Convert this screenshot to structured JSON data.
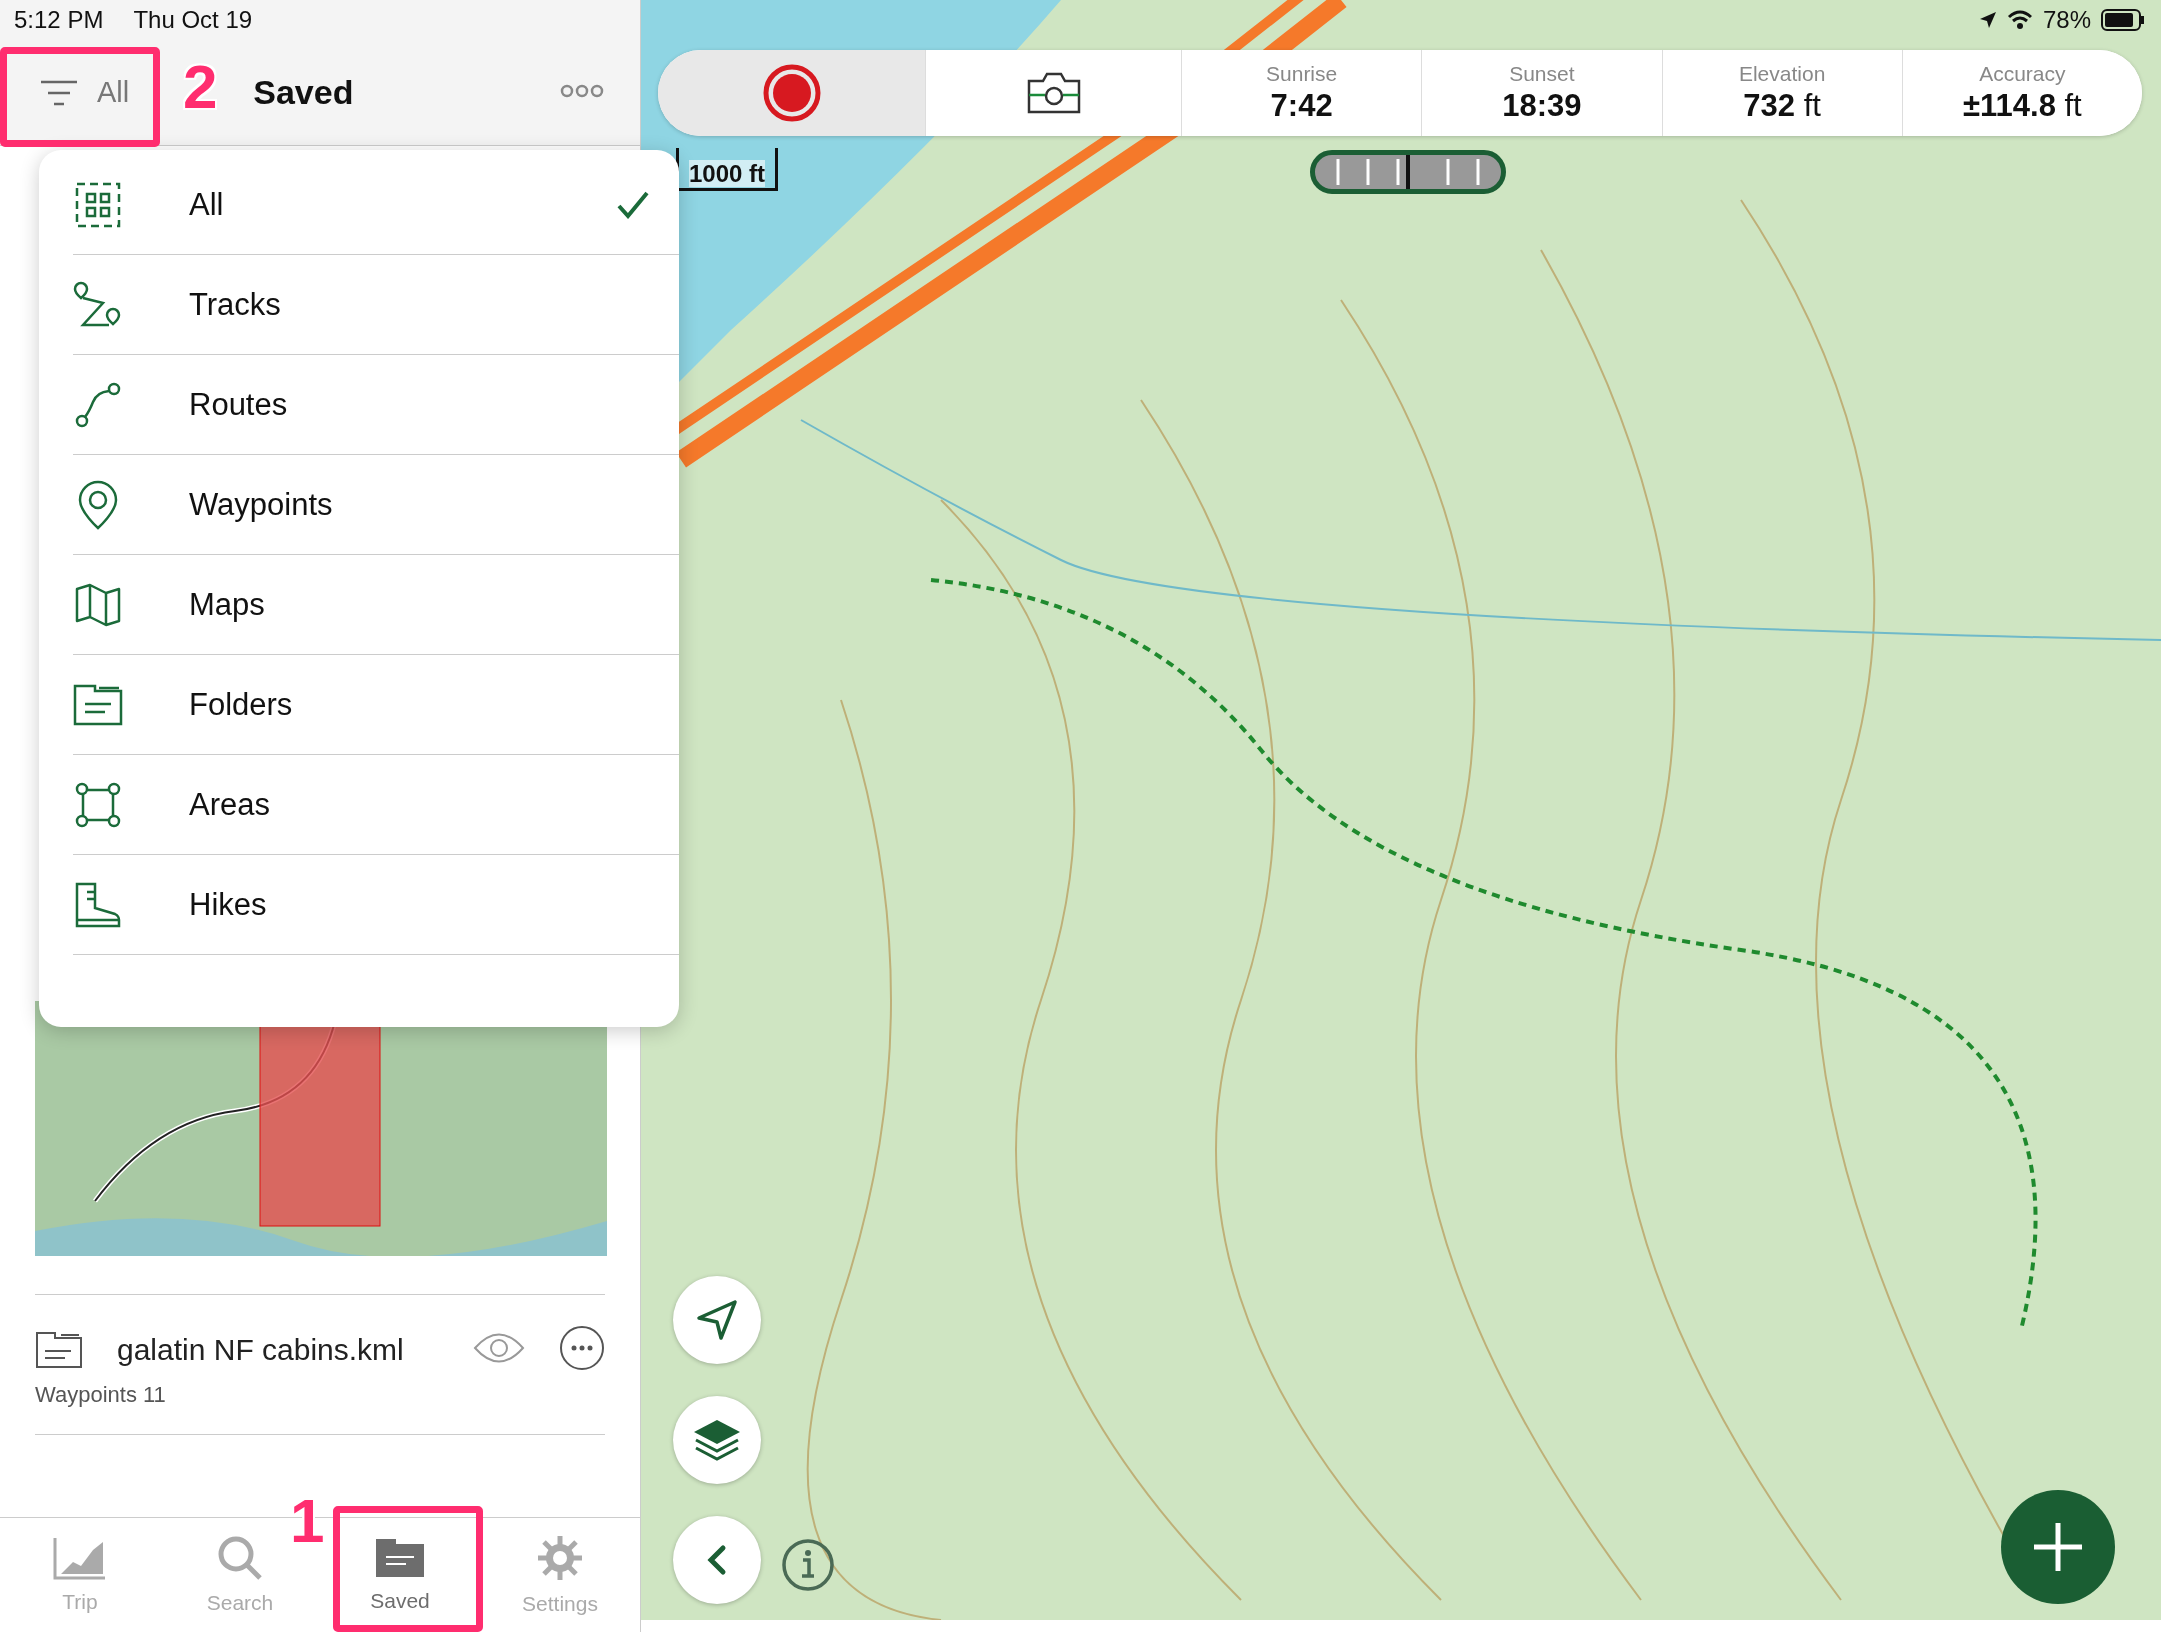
{
  "status_bar": {
    "time": "5:12 PM",
    "date": "Thu Oct 19",
    "battery": "78%"
  },
  "header": {
    "filter_button": {
      "label": "All"
    },
    "title": "Saved"
  },
  "callouts": [
    "2",
    "1"
  ],
  "filter_menu": {
    "items": [
      {
        "label": "All",
        "kind": "all",
        "selected": true
      },
      {
        "label": "Tracks",
        "kind": "tracks",
        "selected": false
      },
      {
        "label": "Routes",
        "kind": "routes",
        "selected": false
      },
      {
        "label": "Waypoints",
        "kind": "waypoints",
        "selected": false
      },
      {
        "label": "Maps",
        "kind": "maps",
        "selected": false
      },
      {
        "label": "Folders",
        "kind": "folders",
        "selected": false
      },
      {
        "label": "Areas",
        "kind": "areas",
        "selected": false
      },
      {
        "label": "Hikes",
        "kind": "hikes",
        "selected": false
      }
    ]
  },
  "saved_list": {
    "items": [
      {
        "name": "galatin NF cabins.kml",
        "detail": "Waypoints 11"
      }
    ]
  },
  "tab_bar": {
    "tabs": [
      {
        "label": "Trip",
        "kind": "trip",
        "selected": false
      },
      {
        "label": "Search",
        "kind": "search",
        "selected": false
      },
      {
        "label": "Saved",
        "kind": "saved",
        "selected": true
      },
      {
        "label": "Settings",
        "kind": "settings",
        "selected": false
      }
    ]
  },
  "map_toolbar": {
    "stats": [
      {
        "label": "Sunrise",
        "value": "7:42"
      },
      {
        "label": "Sunset",
        "value": "18:39"
      },
      {
        "label": "Elevation",
        "value": "732",
        "unit": "ft"
      },
      {
        "label": "Accuracy",
        "value": "±114.8",
        "unit": "ft"
      }
    ]
  },
  "map": {
    "scale": "1000 ft",
    "slider": {
      "level": 0.5
    }
  }
}
